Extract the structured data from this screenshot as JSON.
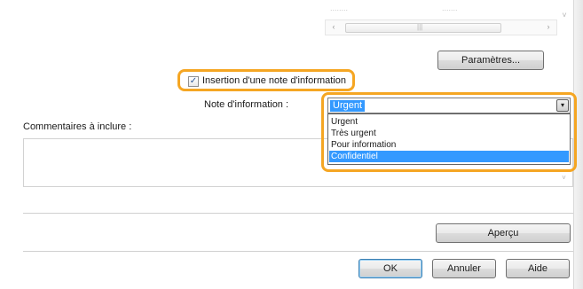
{
  "partial_headers": [
    "........",
    "......."
  ],
  "scrollbar": {
    "left_arrow": "‹",
    "right_arrow": "›",
    "thumb_grip": "|||",
    "up_arrow": "˄",
    "down_arrow": "˅"
  },
  "buttons": {
    "parametres": "Paramètres...",
    "apercu": "Aperçu",
    "ok": "OK",
    "annuler": "Annuler",
    "aide": "Aide"
  },
  "insertion": {
    "label": "Insertion d'une note d'information",
    "checked": true,
    "check_glyph": "✓"
  },
  "note": {
    "label": "Note d'information :",
    "selected_value": "Urgent",
    "options": [
      "Urgent",
      "Très urgent",
      "Pour information",
      "Confidentiel"
    ],
    "highlighted_option": "Confidentiel",
    "dropdown_glyph": "▾"
  },
  "comments": {
    "label": "Commentaires à inclure :",
    "value": ""
  },
  "highlight_color": "#f5a623",
  "selection_color": "#3399ff"
}
